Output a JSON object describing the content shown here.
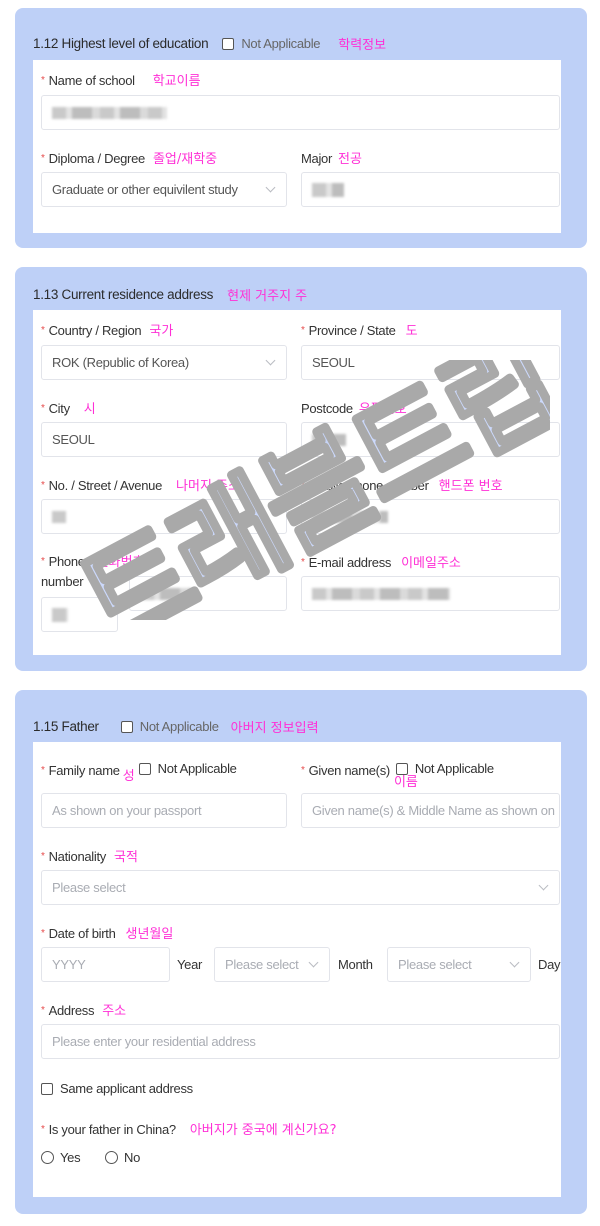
{
  "education": {
    "title": "1.12 Highest level of education",
    "not_applicable": "Not Applicable",
    "note": "학력정보",
    "school_label": "Name of school",
    "school_note": "학교이름",
    "diploma_label": "Diploma / Degree",
    "diploma_note": "졸업/재학중",
    "diploma_value": "Graduate or other equivilent study",
    "major_label": "Major",
    "major_note": "전공"
  },
  "residence": {
    "title": "1.13 Current residence address",
    "note": "현제 거주지 주",
    "country_label": "Country / Region",
    "country_note": "국가",
    "country_value": "ROK (Republic of Korea)",
    "province_label": "Province / State",
    "province_note": "도",
    "province_value": "SEOUL",
    "city_label": "City",
    "city_note": "시",
    "city_value": "SEOUL",
    "postcode_label": "Postcode",
    "postcode_note": "우편번호",
    "street_label": "No. / Street / Avenue",
    "street_note": "나머지 주소",
    "mobile_label": "Mobile phone number",
    "mobile_note": "핸드폰 번호",
    "phone_label_1": "Phone",
    "phone_label_2": "number",
    "phone_note": "전화번호",
    "email_label": "E-mail address",
    "email_note": "이메일주소"
  },
  "father": {
    "title": "1.15 Father",
    "not_applicable": "Not Applicable",
    "note": "아버지 정보입력",
    "family_label": "Family name",
    "family_note": "성",
    "family_na": "Not Applicable",
    "family_placeholder": "As shown on your passport",
    "given_label": "Given name(s)",
    "given_note": "이름",
    "given_na": "Not Applicable",
    "given_placeholder": "Given name(s) & Middle Name as shown on",
    "nationality_label": "Nationality",
    "nationality_note": "국적",
    "nationality_placeholder": "Please select",
    "dob_label": "Date of birth",
    "dob_note": "생년월일",
    "year_placeholder": "YYYY",
    "year_label": "Year",
    "month_placeholder": "Please select",
    "month_label": "Month",
    "day_placeholder": "Please select",
    "day_label": "Day",
    "address_label": "Address",
    "address_note": "주소",
    "address_placeholder": "Please enter your residential address",
    "same_address": "Same applicant address",
    "in_china_label": "Is your father in China?",
    "in_china_note": "아버지가 중국에 계신가요?",
    "yes": "Yes",
    "no": "No"
  },
  "watermark": {
    "text": "트래블트립"
  },
  "colors": {
    "card_bg": "#bed0f7",
    "annotation": "#ff2fd6",
    "required": "#e64a4a"
  }
}
